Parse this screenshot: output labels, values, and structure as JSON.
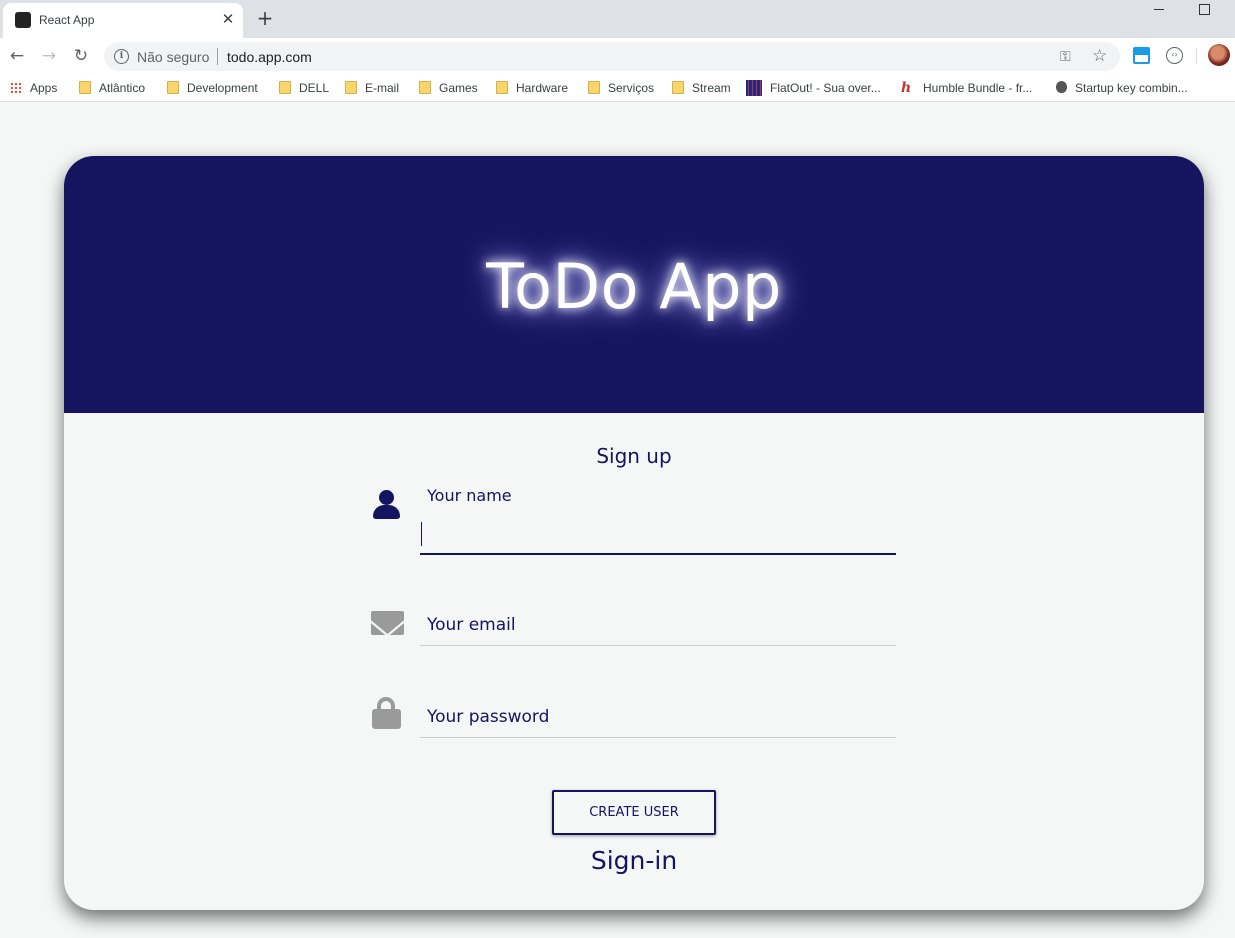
{
  "browser": {
    "tab_title": "React App",
    "tab_close": "✕",
    "new_tab": "+",
    "security_label": "Não seguro",
    "url": "todo.app.com",
    "nav": {
      "back": "←",
      "forward": "→",
      "reload": "↻"
    },
    "bookmarks": [
      {
        "label": "Apps",
        "icon": "apps-grid-icon"
      },
      {
        "label": "Atlântico",
        "icon": "folder-icon"
      },
      {
        "label": "Development",
        "icon": "folder-icon"
      },
      {
        "label": "DELL",
        "icon": "folder-icon"
      },
      {
        "label": "E-mail",
        "icon": "folder-icon"
      },
      {
        "label": "Games",
        "icon": "folder-icon"
      },
      {
        "label": "Hardware",
        "icon": "folder-icon"
      },
      {
        "label": "Serviços",
        "icon": "folder-icon"
      },
      {
        "label": "Stream",
        "icon": "folder-icon"
      },
      {
        "label": "FlatOut! - Sua over...",
        "icon": "flatout-icon"
      },
      {
        "label": "Humble Bundle - fr...",
        "icon": "humble-icon"
      },
      {
        "label": "Startup key combin...",
        "icon": "apple-icon"
      }
    ]
  },
  "app": {
    "title": "ToDo App",
    "form": {
      "heading": "Sign up",
      "name_label": "Your name",
      "email_label": "Your email",
      "password_label": "Your password",
      "name_value": "",
      "email_value": "",
      "password_value": ""
    },
    "create_button": "CREATE USER",
    "signin_link": "Sign-in"
  },
  "colors": {
    "header_bg": "#15145e",
    "accent": "#15145e",
    "page_bg": "#f5f6f6",
    "icon_grey": "#9a9a9a"
  }
}
